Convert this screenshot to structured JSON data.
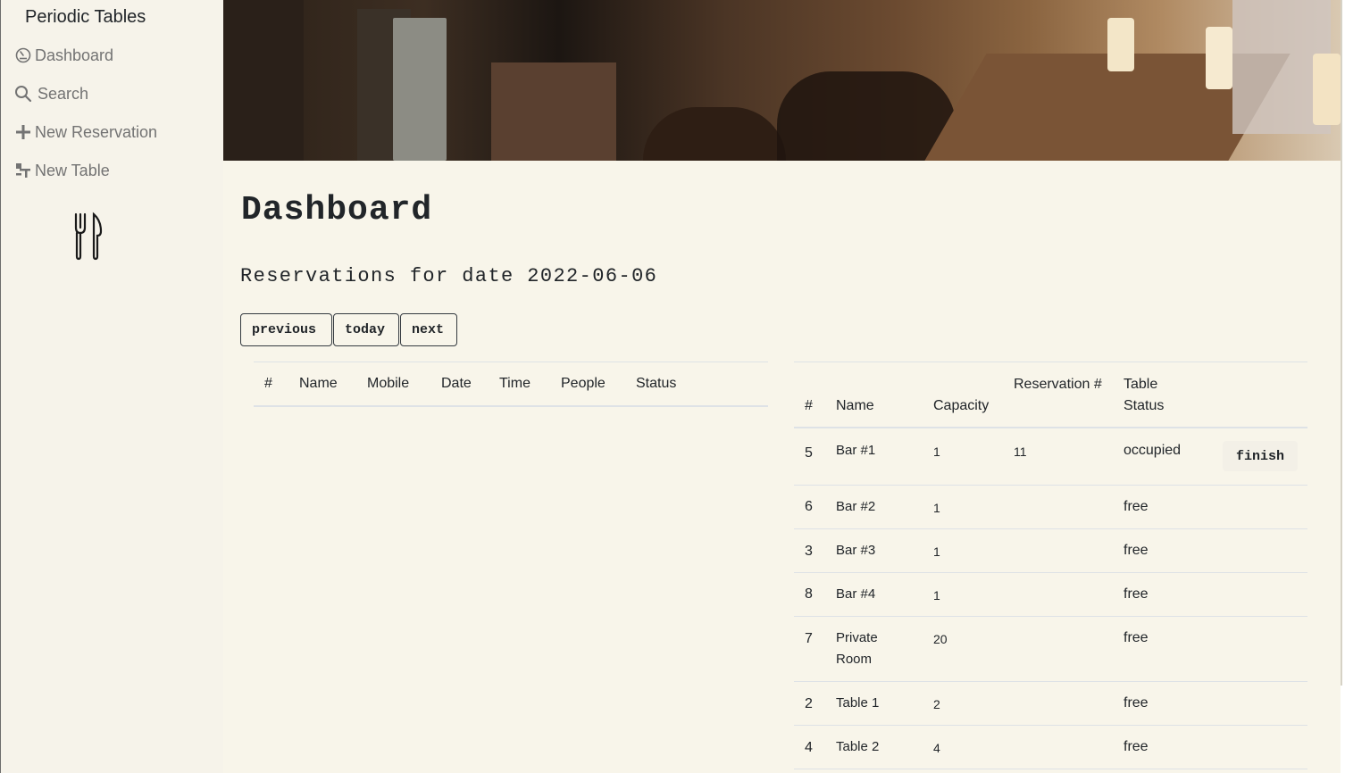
{
  "sidebar": {
    "brand": "Periodic Tables",
    "items": [
      {
        "label": "Dashboard",
        "icon": "dashboard-icon"
      },
      {
        "label": "Search",
        "icon": "search-icon"
      },
      {
        "label": "New Reservation",
        "icon": "plus-icon"
      },
      {
        "label": "New Table",
        "icon": "new-table-icon"
      }
    ],
    "logo_icon": "fork-knife-icon"
  },
  "main": {
    "title": "Dashboard",
    "subtitle": "Reservations for date 2022-06-06",
    "buttons": {
      "previous": "previous",
      "today": "today",
      "next": "next"
    }
  },
  "reservations": {
    "headers": [
      "#",
      "Name",
      "Mobile",
      "Date",
      "Time",
      "People",
      "Status"
    ],
    "rows": []
  },
  "tables": {
    "headers": {
      "id": "#",
      "name": "Name",
      "capacity": "Capacity",
      "reservation": "Reservation #",
      "status": "Table Status"
    },
    "finish_label": "finish",
    "rows": [
      {
        "id": "5",
        "name": "Bar #1",
        "capacity": "1",
        "reservation": "11",
        "status": "occupied"
      },
      {
        "id": "6",
        "name": "Bar #2",
        "capacity": "1",
        "reservation": "",
        "status": "free"
      },
      {
        "id": "3",
        "name": "Bar #3",
        "capacity": "1",
        "reservation": "",
        "status": "free"
      },
      {
        "id": "8",
        "name": "Bar #4",
        "capacity": "1",
        "reservation": "",
        "status": "free"
      },
      {
        "id": "7",
        "name": "Private Room",
        "capacity": "20",
        "reservation": "",
        "status": "free"
      },
      {
        "id": "2",
        "name": "Table 1",
        "capacity": "2",
        "reservation": "",
        "status": "free"
      },
      {
        "id": "4",
        "name": "Table 2",
        "capacity": "4",
        "reservation": "",
        "status": "free"
      }
    ]
  }
}
